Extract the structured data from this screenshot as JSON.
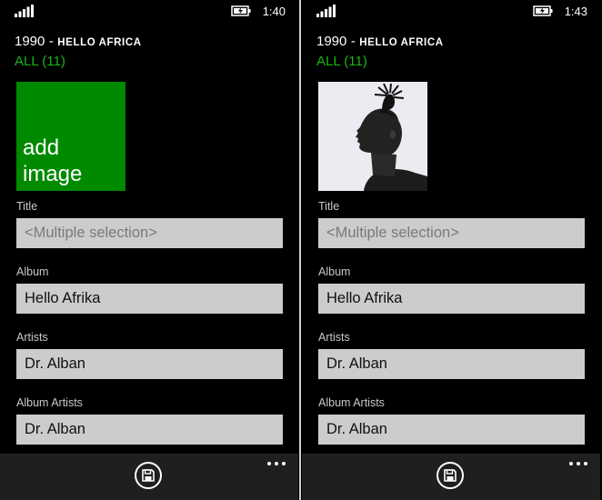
{
  "colors": {
    "accent": "#008a00",
    "link": "#16b516",
    "field_bg": "#cccccc",
    "appbar_bg": "#1f1f1f"
  },
  "screens": [
    {
      "status": {
        "time": "1:40"
      },
      "header": {
        "year": "1990",
        "separator": "-",
        "album": "HELLO AFRICA"
      },
      "all_link": "ALL (11)",
      "art_tile": {
        "kind": "add",
        "label_line1": "add",
        "label_line2": "image"
      },
      "fields": [
        {
          "label": "Title",
          "value": "",
          "placeholder": "<Multiple selection>"
        },
        {
          "label": "Album",
          "value": "Hello Afrika",
          "placeholder": ""
        },
        {
          "label": "Artists",
          "value": "Dr. Alban",
          "placeholder": ""
        },
        {
          "label": "Album Artists",
          "value": "Dr. Alban",
          "placeholder": ""
        }
      ],
      "app_bar": {
        "primary_icon": "save-icon",
        "more_icon": "ellipsis-icon"
      }
    },
    {
      "status": {
        "time": "1:43"
      },
      "header": {
        "year": "1990",
        "separator": "-",
        "album": "HELLO AFRICA"
      },
      "all_link": "ALL (11)",
      "art_tile": {
        "kind": "photo",
        "image": "album-art-portrait"
      },
      "fields": [
        {
          "label": "Title",
          "value": "",
          "placeholder": "<Multiple selection>"
        },
        {
          "label": "Album",
          "value": "Hello Afrika",
          "placeholder": ""
        },
        {
          "label": "Artists",
          "value": "Dr. Alban",
          "placeholder": ""
        },
        {
          "label": "Album Artists",
          "value": "Dr. Alban",
          "placeholder": ""
        }
      ],
      "app_bar": {
        "primary_icon": "save-icon",
        "more_icon": "ellipsis-icon"
      }
    }
  ]
}
